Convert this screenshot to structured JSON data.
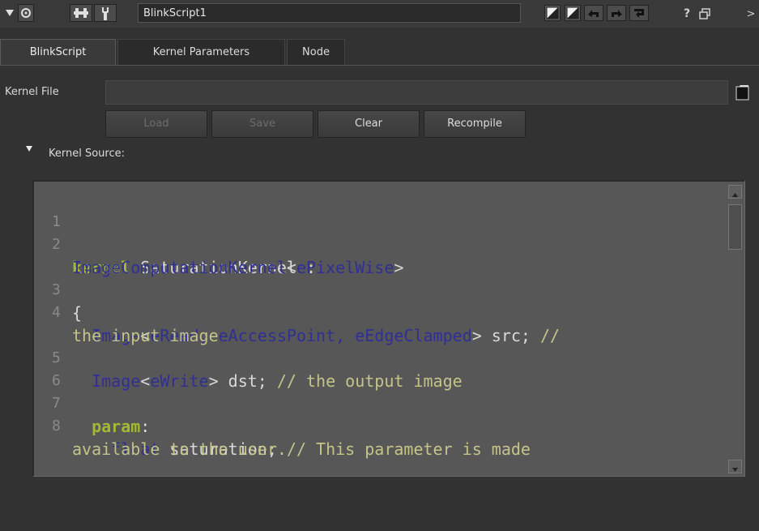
{
  "node": {
    "name": "BlinkScript1"
  },
  "titlebar": {
    "icons": [
      "collapse-arrow-icon",
      "viewer-circle-icon",
      "node-graph-icon",
      "wrench-icon"
    ],
    "right_icons": [
      "color-swatch-1-icon",
      "color-swatch-2-icon",
      "undo-icon",
      "redo-icon",
      "revert-icon",
      "help-icon",
      "float-icon",
      "close-icon"
    ],
    "help_label": "?",
    "close_label": ">"
  },
  "tabs": [
    {
      "label": "BlinkScript",
      "active": true
    },
    {
      "label": "Kernel Parameters",
      "active": false
    },
    {
      "label": "Node",
      "active": false
    }
  ],
  "kernel_file": {
    "label": "Kernel File",
    "value": "",
    "placeholder": ""
  },
  "buttons": {
    "load": "Load",
    "save": "Save",
    "clear": "Clear",
    "recompile": "Recompile"
  },
  "kernel_source": {
    "label": "Kernel Source:"
  },
  "code": {
    "lines": [
      {
        "n": "1"
      },
      {
        "n": "2",
        "kw": "kernel",
        "text": " SaturationKernel :"
      },
      {
        "wrap_type": "ImageComputationKernel",
        "wrap_lt": "<",
        "wrap_ty2": "ePixelWise",
        "wrap_gt": ">"
      },
      {
        "n": "3",
        "text": "{"
      },
      {
        "n": "4",
        "ty": "  Image",
        "lt": "<",
        "args": "eRead, eAccessPoint, eEdgeClamped",
        "gt": ">",
        "text": " src; ",
        "cm": "//"
      },
      {
        "wrap_cm": "the input image"
      },
      {
        "n": "5",
        "ty": "  Image",
        "lt": "<",
        "args": "eWrite",
        "gt": ">",
        "text": " dst; ",
        "cm": "// the output image"
      },
      {
        "n": "6"
      },
      {
        "n": "7",
        "kw": "  param",
        "text": ":"
      },
      {
        "n": "8",
        "ty": "    float",
        "text": " saturation; ",
        "cm": "// This parameter is made"
      },
      {
        "wrap_cm": "available to the user."
      }
    ]
  },
  "colors": {
    "keyword": "#a3b934",
    "type": "#2f2f94",
    "comment": "#c4c48a",
    "editor_bg": "#575757",
    "panel_bg": "#323232"
  }
}
